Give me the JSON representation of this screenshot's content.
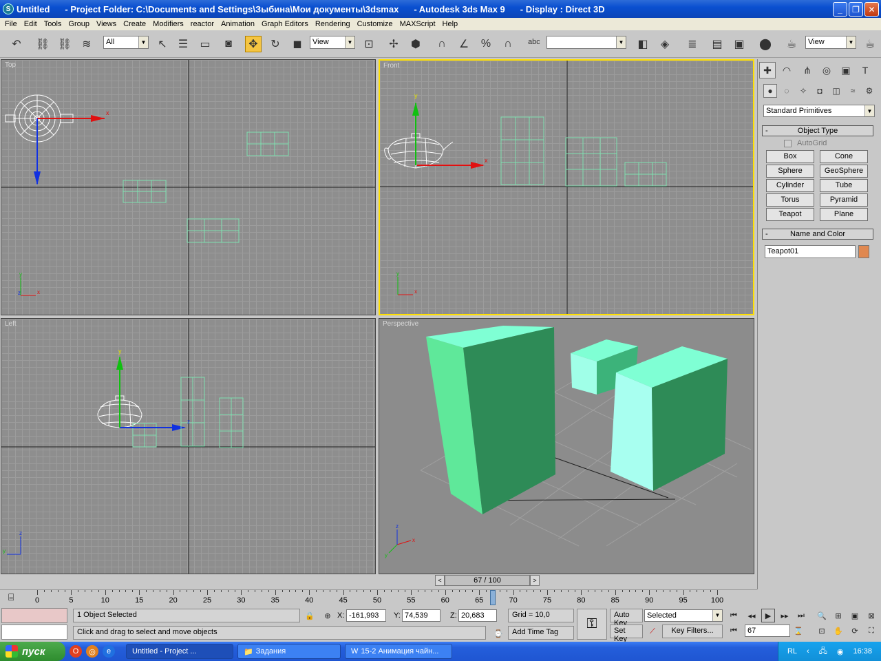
{
  "window": {
    "title_parts": [
      "Untitled",
      "- Project Folder: C:\\Documents and Settings\\Зыбина\\Мои документы\\3dsmax",
      "- Autodesk 3ds Max 9",
      "- Display : Direct 3D"
    ]
  },
  "menu": [
    "File",
    "Edit",
    "Tools",
    "Group",
    "Views",
    "Create",
    "Modifiers",
    "reactor",
    "Animation",
    "Graph Editors",
    "Rendering",
    "Customize",
    "MAXScript",
    "Help"
  ],
  "toolbar": {
    "selection_filter": "All",
    "reference_coord": "View",
    "named_selection": "",
    "render_view": "View"
  },
  "viewports": {
    "top": "Top",
    "front": "Front",
    "left": "Left",
    "perspective": "Perspective"
  },
  "axes": {
    "x": "x",
    "y": "y",
    "z": "z"
  },
  "command_panel": {
    "category": "Standard Primitives",
    "object_type_title": "Object Type",
    "autogrid": "AutoGrid",
    "buttons": [
      "Box",
      "Cone",
      "Sphere",
      "GeoSphere",
      "Cylinder",
      "Tube",
      "Torus",
      "Pyramid",
      "Teapot",
      "Plane"
    ],
    "name_color_title": "Name and Color",
    "object_name": "Teapot01",
    "object_color": "#e08850",
    "rollout_minus": "-"
  },
  "time_slider": {
    "frame": "67 / 100",
    "current": 67,
    "total": 100,
    "prev": "<",
    "next": ">"
  },
  "ruler": {
    "ticks": [
      0,
      5,
      10,
      15,
      20,
      25,
      30,
      35,
      40,
      45,
      50,
      55,
      60,
      65,
      70,
      75,
      80,
      85,
      90,
      95,
      100
    ]
  },
  "status": {
    "selected": "1 Object Selected",
    "prompt": "Click and drag to select and move objects",
    "x_label": "X:",
    "x": "-161,993",
    "y_label": "Y:",
    "y": "74,539",
    "z_label": "Z:",
    "z": "20,683",
    "grid": "Grid = 10,0",
    "add_time_tag": "Add Time Tag",
    "auto_key": "Auto Key",
    "set_key": "Set Key",
    "key_mode": "Selected",
    "key_filters": "Key Filters...",
    "current_frame": "67"
  },
  "taskbar": {
    "start": "пуск",
    "tasks": [
      "Untitled     - Project ...",
      "Задания",
      "15-2 Анимация чайн..."
    ],
    "lang": "RL",
    "clock": "16:38"
  },
  "colors": {
    "wire": "#7fe0b0",
    "box_top": "#7fffd4",
    "box_side": "#2e8b57",
    "box_front": "#5fe89a",
    "active_vp": "#ffe000"
  }
}
